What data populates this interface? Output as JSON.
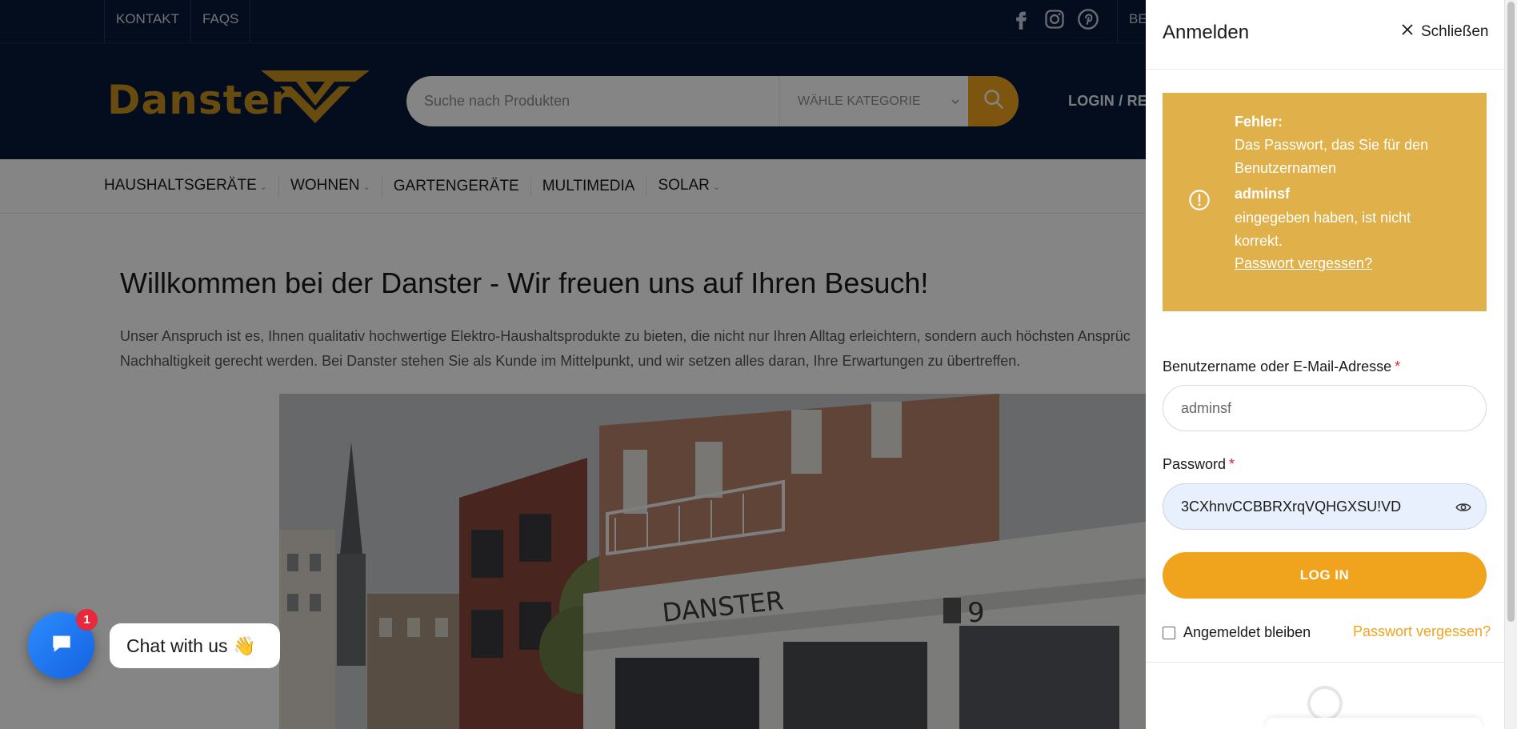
{
  "topbar": {
    "links": [
      "KONTAKT",
      "FAQS"
    ],
    "right_text": "BEST"
  },
  "header": {
    "logo_text": "Danster",
    "search_placeholder": "Suche nach Produkten",
    "category_label": "WÄHLE KATEGORIE",
    "login_label": "LOGIN / REG"
  },
  "nav": {
    "items": [
      {
        "label": "HAUSHALTSGERÄTE",
        "dropdown": true
      },
      {
        "label": "WOHNEN",
        "dropdown": true
      },
      {
        "label": "GARTENGERÄTE",
        "dropdown": false
      },
      {
        "label": "MULTIMEDIA",
        "dropdown": false
      },
      {
        "label": "SOLAR",
        "dropdown": true
      }
    ]
  },
  "main": {
    "title": "Willkommen bei der Danster - Wir freuen uns auf Ihren Besuch!",
    "text": "Unser Anspruch ist es, Ihnen qualitativ hochwertige Elektro-Haushaltsprodukte zu bieten, die nicht nur Ihren Alltag erleichtern, sondern auch höchsten Ansprüc Nachhaltigkeit gerecht werden. Bei Danster stehen Sie als Kunde im Mittelpunkt, und wir setzen alles daran, Ihre Erwartungen zu übertreffen.",
    "hero_sign": "DANSTER",
    "hero_number": "9"
  },
  "chat": {
    "badge": "1",
    "bubble": "Chat with us 👋"
  },
  "panel": {
    "title": "Anmelden",
    "close_label": "Schließen",
    "error": {
      "heading": "Fehler:",
      "line1": "Das Passwort, das Sie für den Benutzernamen",
      "username": "adminsf",
      "line2": "eingegeben haben, ist nicht korrekt.",
      "link": "Passwort vergessen?"
    },
    "username_label": "Benutzername oder E-Mail-Adresse",
    "username_value": "adminsf",
    "password_label": "Password",
    "password_value": "3CXhnvCCBBRXrqVQHGXSU!VD",
    "required_mark": "*",
    "login_button": "LOG IN",
    "remember_label": "Angemeldet bleiben",
    "forgot_link": "Passwort vergessen?"
  },
  "colors": {
    "dark_navy": "#061a3a",
    "accent_orange": "#f0a41e",
    "error_bg": "#e0b04a",
    "logo_gold": "#c8911d"
  }
}
